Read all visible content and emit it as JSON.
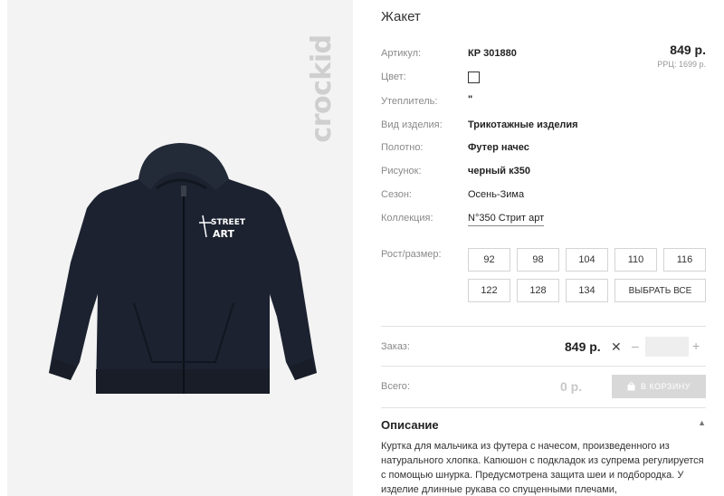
{
  "product": {
    "title": "Жакет",
    "price": "849 р.",
    "rrp": "РРЦ: 1699 р.",
    "brand": "crockid",
    "print_line1": "STREET",
    "print_line2": "ART"
  },
  "attributes": [
    {
      "label": "Артикул:",
      "value": "КР 301880"
    },
    {
      "label": "Цвет:",
      "value": ""
    },
    {
      "label": "Утеплитель:",
      "value": "\""
    },
    {
      "label": "Вид изделия:",
      "value": "Трикотажные изделия"
    },
    {
      "label": "Полотно:",
      "value": "Футер начес"
    },
    {
      "label": "Рисунок:",
      "value": "черный к350"
    },
    {
      "label": "Сезон:",
      "value": "Осень-Зима"
    },
    {
      "label": "Коллекция:",
      "value": "N°350 Стрит арт"
    }
  ],
  "sizes": {
    "label": "Рост/размер:",
    "options": [
      "92",
      "98",
      "104",
      "110",
      "116",
      "122",
      "128",
      "134"
    ],
    "select_all": "ВЫБРАТЬ ВСЕ"
  },
  "order": {
    "label": "Заказ:",
    "price": "849 р.",
    "remove_symbol": "✕",
    "minus": "–",
    "plus": "+",
    "qty_value": ""
  },
  "total": {
    "label": "Всего:",
    "value": "0 р.",
    "cart_button": "В КОРЗИНУ"
  },
  "description": {
    "title": "Описание",
    "text": "Куртка для мальчика из футера с начесом, произведенного из натурального хлопка. Капюшон с подкладок из супрема регулируется с помощью шнурка. Предусмотрена защита шеи и подбородка. У изделие длинные рукава со спущенными плечами,"
  },
  "colors": {
    "photo_bg": "#f3f3f3",
    "jacket": "#1c2230",
    "cart_button_disabled": "#d8d8d8"
  }
}
